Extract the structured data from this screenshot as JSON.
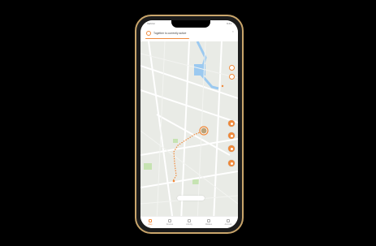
{
  "status_bar": {
    "carrier": "Verizon",
    "time": "9:41"
  },
  "banner": {
    "message": "Together is currently active",
    "close_icon": "close-icon"
  },
  "map_pill": {
    "label": ""
  },
  "tabs": [
    {
      "label": "Map",
      "icon": "map-icon",
      "active": true
    },
    {
      "label": "Devices",
      "icon": "devices-icon",
      "active": false
    },
    {
      "label": "Activity",
      "icon": "activity-icon",
      "active": false
    },
    {
      "label": "Walkies",
      "icon": "walkies-icon",
      "active": false
    },
    {
      "label": "Account",
      "icon": "account-icon",
      "active": false
    }
  ],
  "colors": {
    "accent": "#f08a3c",
    "map_bg": "#e9ebe6",
    "water": "#9bc9f0",
    "park": "#c6e3b2",
    "phone_frame": "#c9a56b"
  }
}
